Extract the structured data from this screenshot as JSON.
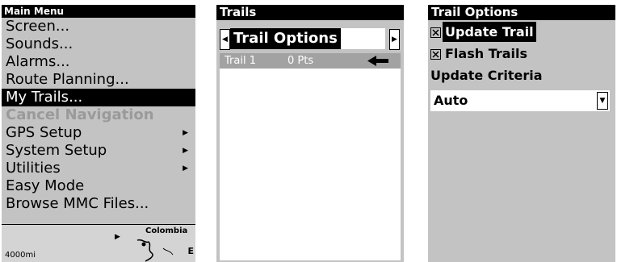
{
  "main_menu": {
    "title": "Main Menu",
    "items": [
      {
        "label": "Screen..."
      },
      {
        "label": "Sounds..."
      },
      {
        "label": "Alarms..."
      },
      {
        "label": "Route Planning..."
      },
      {
        "label": "My Trails...",
        "selected": true
      },
      {
        "label": "Cancel Navigation",
        "disabled": true
      },
      {
        "label": "GPS Setup",
        "submenu": true
      },
      {
        "label": "System Setup",
        "submenu": true
      },
      {
        "label": "Utilities",
        "submenu": true
      },
      {
        "label": "Easy Mode"
      },
      {
        "label": "Browse MMC Files..."
      }
    ],
    "submenu_arrow_icon": "triangle-right-icon",
    "map": {
      "scale": "4000mi",
      "place": "Colombia",
      "edge_letter": "E"
    }
  },
  "trails": {
    "title": "Trails",
    "nav_label": "Trail Options",
    "left_arrow_icon": "triangle-left-icon",
    "right_arrow_icon": "triangle-right-icon",
    "list": [
      {
        "name": "Trail 1",
        "points": "0 Pts",
        "icon": "arrow-left-icon"
      }
    ]
  },
  "trail_options": {
    "title": "Trail Options",
    "update_trail": {
      "label": "Update Trail",
      "checked": true
    },
    "flash_trails": {
      "label": "Flash Trails",
      "checked": true
    },
    "criteria_label": "Update Criteria",
    "criteria_value": "Auto",
    "dropdown_icon": "triangle-down-icon"
  },
  "colors": {
    "panel": "#c3c3c3",
    "selection": "#000000",
    "trail_row": "#a2a2a2",
    "disabled_text": "#9a9a9a"
  }
}
